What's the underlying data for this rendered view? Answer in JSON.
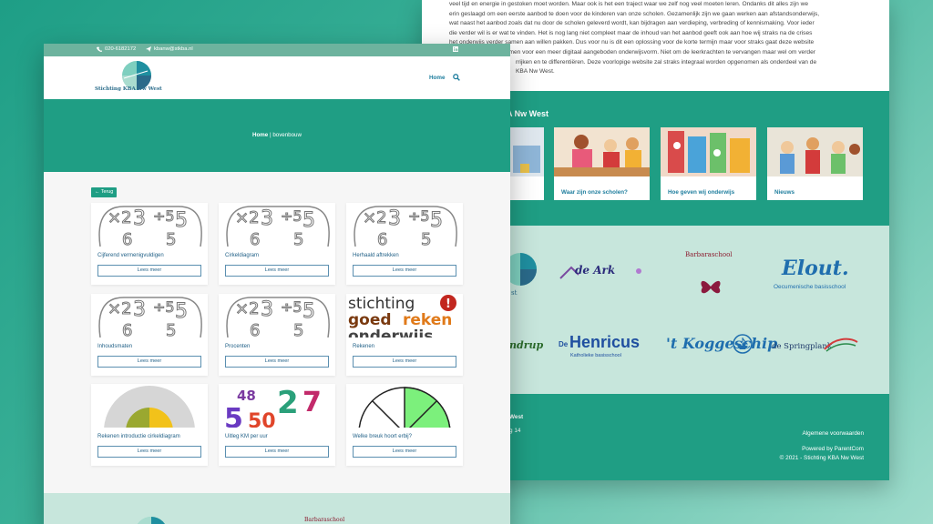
{
  "back_page": {
    "intro_lines": [
      "veel tijd en energie in gestoken moet worden. Maar ook is het een traject waar we zelf nog veel moeten leren. Ondanks dit alles zijn we",
      "erin geslaagd om een eerste aanbod te doen voor de kinderen van onze scholen. Gezamenlijk zijn we gaan werken aan afstandsonderwijs,",
      "wat naast het aanbod zoals dat nu door de scholen geleverd wordt, kan bijdragen aan verdieping, verbreding of kennismaking. Voor ieder",
      "die verder wil is er wat te vinden. Het is nog lang niet compleet maar de inhoud van het aanbod geeft ook aan hoe wij straks na de crises",
      "het onderwijs verder samen aan willen pakken. Dus voor nu is dit een oplossing voor de korte termijn maar voor straks gaat deze website",
      "mmen voor een meer digitaal aangeboden onderwijsvorm. Niet om de leerkrachten te vervangen maar wel om verder",
      "rrijken en te differentiëren. Deze voorlopige website zal straks integraal worden opgenomen als onderdeel van de",
      "KBA Nw West."
    ],
    "section_title": "g KBA Nw West",
    "cards": [
      {
        "label": "or"
      },
      {
        "label": "Waar zijn onze scholen?"
      },
      {
        "label": "Hoe geven wij onderwijs"
      },
      {
        "label": "Nieuws"
      }
    ],
    "logos": {
      "de_ark": "de Ark",
      "barbaraschool": "Barbaraschool",
      "elout": "Elout.",
      "elout_sub": "Oecumenische basisschool",
      "henricus": "Henricus",
      "henricus_prefix": "De",
      "henricus_sub": "Katholieke basisschool",
      "koggeschip": "'t Koggeschip",
      "springplank": "de Springplank",
      "partial_left_1": "st",
      "partial_left_2": "ndrup"
    },
    "footer": {
      "left_title": "West",
      "left_line": "g 14",
      "terms": "Algemene voorwaarden",
      "powered": "Powered by ParentCom",
      "copyright": "© 2021 - Stichting KBA Nw West"
    }
  },
  "front_page": {
    "topbar": {
      "phone": "020-6182172",
      "email": "kbanw@stkba.nl",
      "social_icon": "linkedin-icon"
    },
    "brand": {
      "name": "Stichting KBA Nw West"
    },
    "nav": {
      "home": "Home",
      "search_icon": "search-icon"
    },
    "breadcrumb": {
      "home": "Home",
      "separator": "|",
      "current": "bovenbouw"
    },
    "back_button": "← Terug",
    "cards": [
      {
        "title": "Cijferend vermenigvuldigen",
        "button": "Lees meer",
        "thumb": "numbers"
      },
      {
        "title": "Cirkeldiagram",
        "button": "Lees meer",
        "thumb": "numbers"
      },
      {
        "title": "Herhaald aftrekken",
        "button": "Lees meer",
        "thumb": "numbers"
      },
      {
        "title": "Inhoudsmaten",
        "button": "Lees meer",
        "thumb": "numbers"
      },
      {
        "title": "Procenten",
        "button": "Lees meer",
        "thumb": "numbers"
      },
      {
        "title": "Rekenen",
        "button": "Lees meer",
        "thumb": "rekenen"
      },
      {
        "title": "Rekenen introductie cirkeldiagram",
        "button": "Lees meer",
        "thumb": "pie"
      },
      {
        "title": "Uitleg KM per uur",
        "button": "Lees meer",
        "thumb": "colornumbers"
      },
      {
        "title": "Welke breuk hoort erbij?",
        "button": "Lees meer",
        "thumb": "fraction"
      }
    ],
    "rekenen_thumb": {
      "line1": "stichting",
      "line2a": "goed",
      "line2b": "reken",
      "line3": "onderwijs",
      "badge": "!"
    },
    "numbers_thumb": {
      "a": "×2",
      "b": "3",
      "c": "÷5",
      "d": "6",
      "e": "5"
    },
    "colornumbers_thumb": {
      "a": "48",
      "b": "2",
      "c": "7",
      "d": "50",
      "e": "5"
    },
    "footer_logo_text": "Barbaraschool"
  },
  "colors": {
    "brand_green": "#1f9e84",
    "link_blue": "#1f5f86",
    "light_mint": "#c7e6dc"
  }
}
